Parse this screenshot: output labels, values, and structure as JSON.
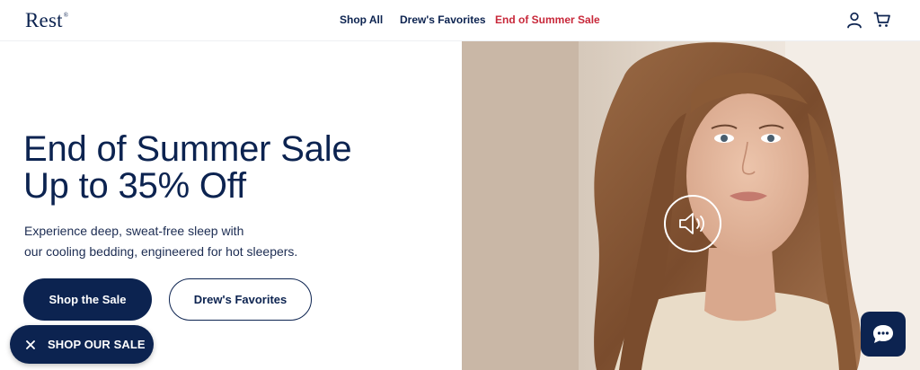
{
  "brand": {
    "logo": "Rest",
    "mark": "®"
  },
  "nav": {
    "items": [
      {
        "label": "Shop All"
      },
      {
        "label": "Drew's Favorites"
      },
      {
        "label": "End of Summer Sale"
      }
    ]
  },
  "header_icons": {
    "account": "user-icon",
    "cart": "cart-icon"
  },
  "hero": {
    "title_line1": "End of Summer Sale",
    "title_line2": "Up to 35% Off",
    "copy_line1": "Experience deep, sweat-free sleep with",
    "copy_line2": "our cooling bedding, engineered for hot sleepers.",
    "primary_cta": "Shop the Sale",
    "secondary_cta": "Drew's Favorites"
  },
  "promo_pill": {
    "label": "SHOP OUR SALE",
    "icon": "close-icon"
  },
  "video": {
    "sound_icon": "speaker-icon"
  },
  "chat": {
    "icon": "chat-bubble-icon"
  },
  "colors": {
    "navy": "#0c2350",
    "sale_red": "#c8283a",
    "white": "#ffffff"
  }
}
